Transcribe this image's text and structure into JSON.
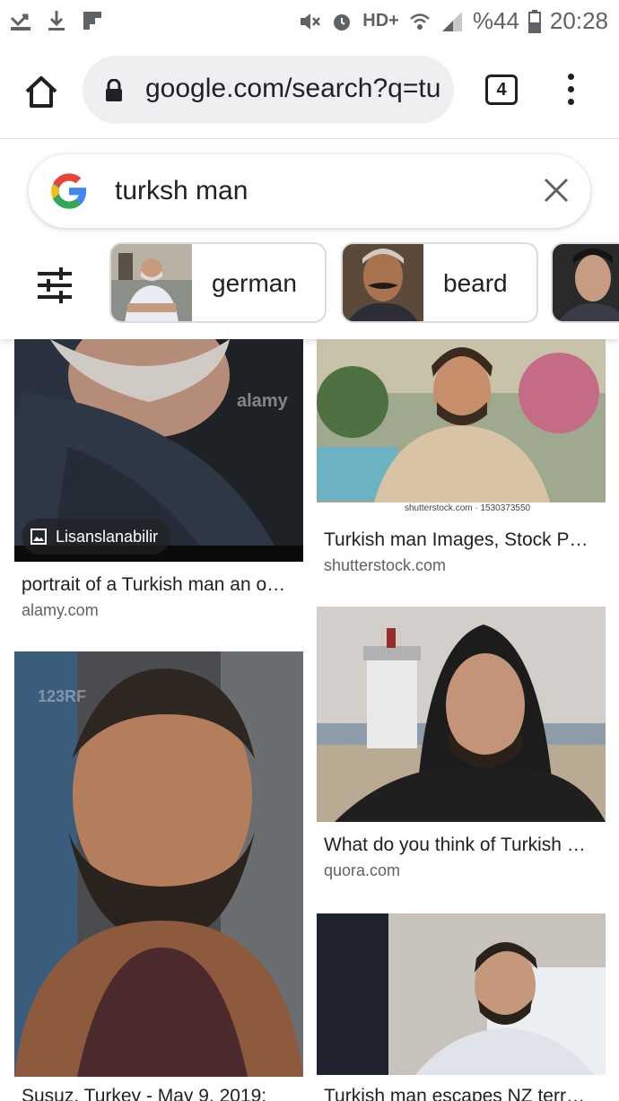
{
  "status_bar": {
    "battery": "%44",
    "time": "20:28",
    "network": "HD+"
  },
  "browser": {
    "url": "google.com/search?q=tu",
    "tab_count": "4"
  },
  "search": {
    "query": "turksh man"
  },
  "chips": [
    {
      "label": "german"
    },
    {
      "label": "beard"
    },
    {
      "label": ""
    }
  ],
  "results": [
    {
      "title": "portrait of a Turkish man an o…",
      "source": "alamy.com",
      "badge": "Lisanslanabilir",
      "watermark": "alamy"
    },
    {
      "title": "Turkish man Images, Stock P…",
      "source": "shutterstock.com",
      "watermark": "shutterstock.com · 1530373550"
    },
    {
      "title": "What do you think of Turkish …",
      "source": "quora.com"
    },
    {
      "title": "Susuz, Turkey - May 9, 2019:",
      "source": "",
      "watermark": "123RF"
    },
    {
      "title": "Turkish man escapes NZ terr…",
      "source": ""
    }
  ],
  "colors": {
    "url_bg": "#eeeff1",
    "source_text": "#5f6368",
    "title_text": "#202124"
  }
}
